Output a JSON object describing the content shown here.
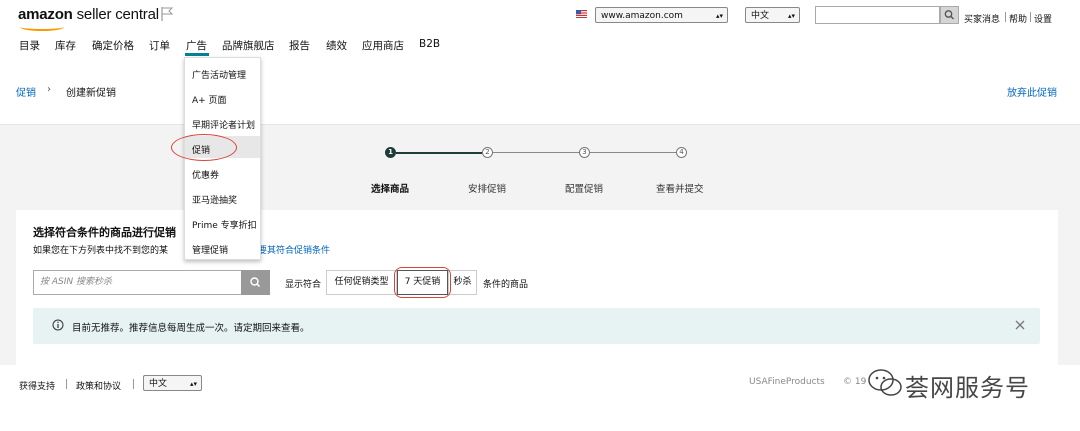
{
  "header": {
    "logo": {
      "brand": "amazon",
      "product": "seller central"
    },
    "nav": [
      "目录",
      "库存",
      "确定价格",
      "订单",
      "广告",
      "品牌旗舰店",
      "报告",
      "绩效",
      "应用商店",
      "B2B"
    ],
    "marketplace": "www.amazon.com",
    "language": "中文",
    "links": [
      "买家消息",
      "帮助",
      "设置"
    ],
    "search_value": ""
  },
  "dropdown": {
    "items": [
      "广告活动管理",
      "A+ 页面",
      "早期评论者计划",
      "促销",
      "优惠券",
      "亚马逊抽奖",
      "Prime 专享折扣",
      "管理促销"
    ],
    "highlighted": "促销"
  },
  "breadcrumb": {
    "root": "促销",
    "separator": "›",
    "current": "创建新促销",
    "discard": "放弃此促销"
  },
  "steps": [
    {
      "number": "1",
      "label": "选择商品",
      "active": true
    },
    {
      "number": "2",
      "label": "安排促销",
      "active": false
    },
    {
      "number": "3",
      "label": "配置促销",
      "active": false
    },
    {
      "number": "4",
      "label": "查看并提交",
      "active": false
    }
  ],
  "card": {
    "title": "选择符合条件的商品进行促销",
    "subtitle": "如果您在下方列表中找不到您的某",
    "subtitle_link": "要其符合促销条件",
    "search_placeholder": "按 ASIN 搜索秒杀",
    "filter_prefix": "显示符合",
    "filter_options": [
      "任何促销类型",
      "7 天促销",
      "秒杀"
    ],
    "filter_selected": "7 天促销",
    "filter_suffix": "条件的商品"
  },
  "alert": {
    "text": "目前无推荐。推荐信息每周生成一次。请定期回来查看。",
    "icon": "info-icon"
  },
  "footer": {
    "links": [
      "获得支持",
      "政策和协议"
    ],
    "language": "中文",
    "brand": "USAFineProducts",
    "copyright": "© 19"
  },
  "watermark": "荟网服务号",
  "colors": {
    "accent": "#008296",
    "step_active": "#1d3d3a",
    "link": "#0066c0",
    "annotation": "#d9453a",
    "alert_bg": "#e6f3f2"
  }
}
